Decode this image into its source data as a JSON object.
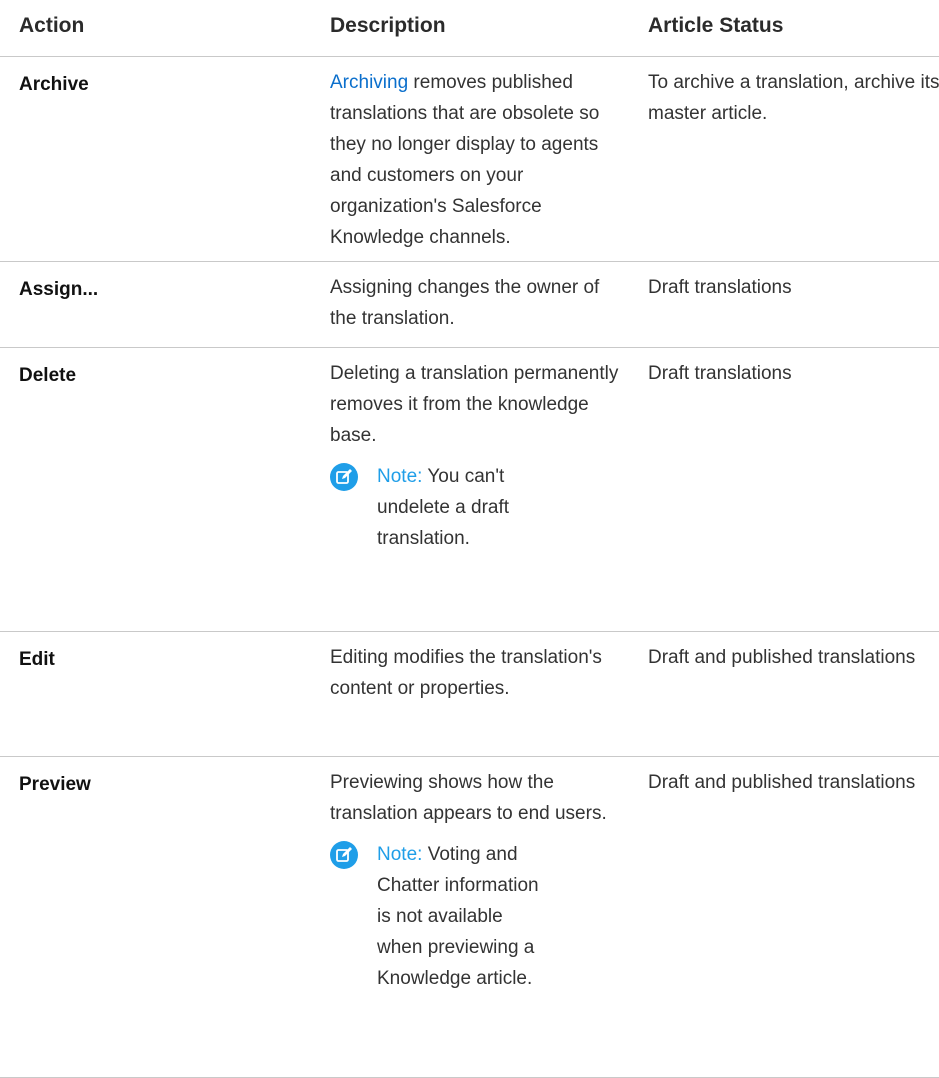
{
  "header": {
    "action": "Action",
    "description": "Description",
    "status": "Article Status"
  },
  "rows": [
    {
      "action": "Archive",
      "description_link": "Archiving",
      "description": " removes published translations that are obsolete so they no longer display to agents and customers on your organization's Salesforce Knowledge channels.",
      "status": "To archive a translation, archive its master article."
    },
    {
      "action": "Assign...",
      "description": "Assigning changes the owner of the translation.",
      "status": "Draft translations"
    },
    {
      "action": "Delete",
      "description": "Deleting a translation permanently removes it from the knowledge base.",
      "note_label": "Note:",
      "note_text": "You can't undelete a draft translation.",
      "status": "Draft translations"
    },
    {
      "action": "Edit",
      "description": "Editing modifies the translation's content or properties.",
      "status": "Draft and published translations"
    },
    {
      "action": "Preview",
      "description": "Previewing shows how the translation appears to end users.",
      "note_label": "Note:",
      "note_text": "Voting and Chatter information is not available when previewing a Knowledge article.",
      "status": "Draft and published translations"
    }
  ],
  "colors": {
    "link": "#0b6fcc",
    "note_accent": "#1f9ee8",
    "divider": "#c9c9c9"
  },
  "icons": [
    "note-edit-icon"
  ]
}
